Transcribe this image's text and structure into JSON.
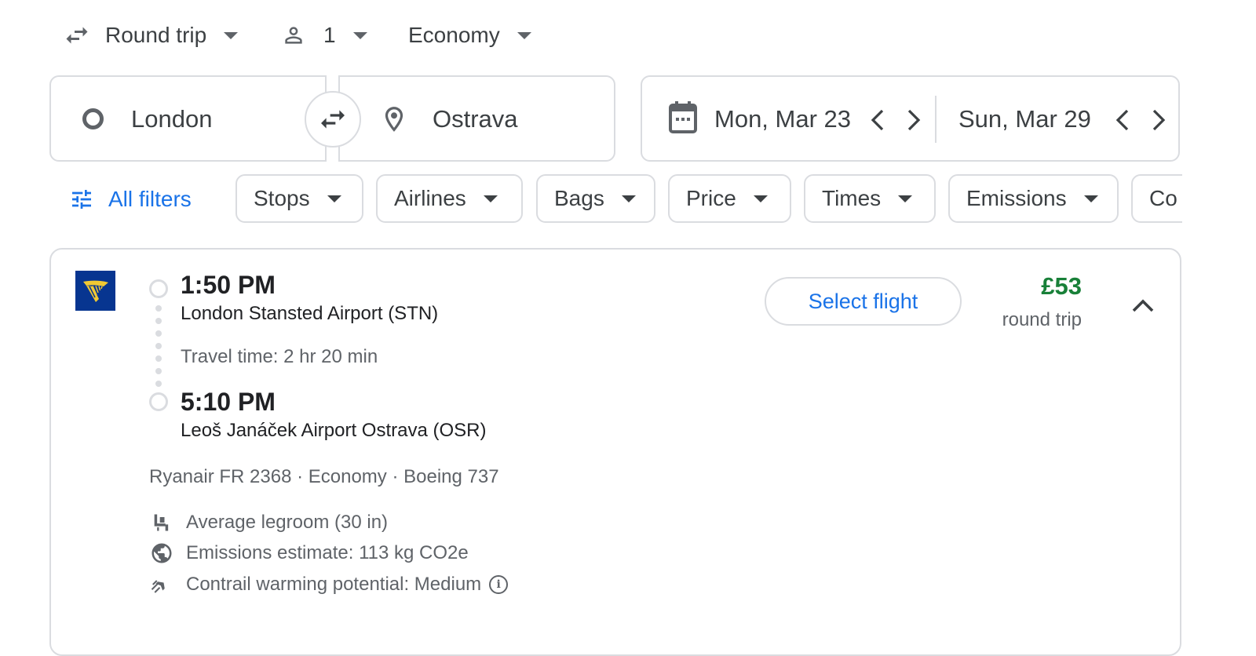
{
  "trip_options": {
    "trip_type": "Round trip",
    "passengers": "1",
    "cabin_class": "Economy"
  },
  "search": {
    "origin": "London",
    "destination": "Ostrava",
    "depart_date": "Mon, Mar 23",
    "return_date": "Sun, Mar 29"
  },
  "filters": {
    "all_filters_label": "All filters",
    "chips": [
      "Stops",
      "Airlines",
      "Bags",
      "Price",
      "Times",
      "Emissions",
      "Co"
    ]
  },
  "flight": {
    "airline_logo": "ryanair-harp-logo",
    "departure_time": "1:50 PM",
    "departure_airport": "London Stansted Airport (STN)",
    "travel_time": "Travel time: 2 hr 20 min",
    "arrival_time": "5:10 PM",
    "arrival_airport": "Leoš Janáček Airport Ostrava (OSR)",
    "details": "Ryanair FR 2368 · Economy · Boeing 737",
    "select_label": "Select flight",
    "price": "£53",
    "price_note": "round trip",
    "amenities": {
      "legroom": "Average legroom (30 in)",
      "emissions": "Emissions estimate: 113 kg CO2e",
      "contrail": "Contrail warming potential: Medium"
    }
  },
  "colors": {
    "accent": "#1a73e8",
    "price": "#188038",
    "ryanair_blue": "#073590",
    "ryanair_yellow": "#f1c933",
    "border": "#dadce0"
  }
}
